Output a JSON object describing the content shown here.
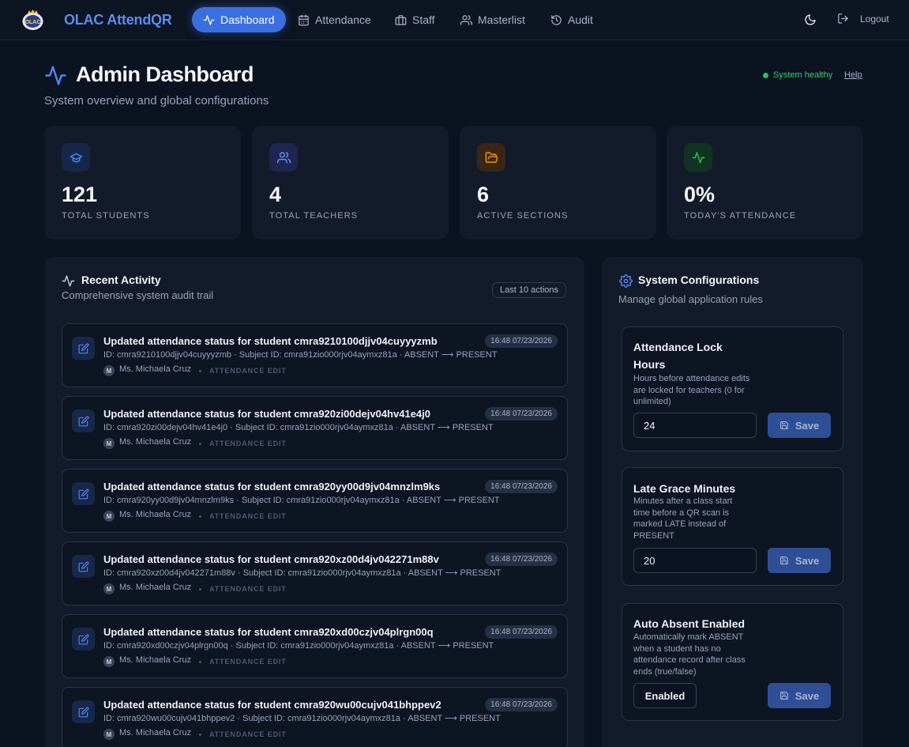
{
  "nav": {
    "brand": "OLAC AttendQR",
    "links": [
      {
        "label": "Dashboard",
        "icon": "activity-icon"
      },
      {
        "label": "Attendance",
        "icon": "calendar-icon"
      },
      {
        "label": "Staff",
        "icon": "briefcase-icon"
      },
      {
        "label": "Masterlist",
        "icon": "users-icon"
      },
      {
        "label": "Audit",
        "icon": "history-icon"
      }
    ],
    "logout_label": "Logout"
  },
  "header": {
    "title": "Admin Dashboard",
    "subtitle": "System overview and global configurations",
    "status": "System healthy",
    "help": "Help"
  },
  "stats": [
    {
      "value": "121",
      "label": "TOTAL STUDENTS",
      "icon": "graduation-cap-icon",
      "color": "#4f86f7"
    },
    {
      "value": "4",
      "label": "TOTAL TEACHERS",
      "icon": "users-icon",
      "color": "#6e8ff7"
    },
    {
      "value": "6",
      "label": "ACTIVE SECTIONS",
      "icon": "folder-open-icon",
      "color": "#f59e0b"
    },
    {
      "value": "0%",
      "label": "TODAY'S ATTENDANCE",
      "icon": "activity-icon",
      "color": "#22c55e"
    }
  ],
  "activity": {
    "title": "Recent Activity",
    "subtitle": "Comprehensive system audit trail",
    "badge": "Last 10 actions",
    "items": [
      {
        "title": "Updated attendance status for student cmra9210100djjv04cuyyyzmb",
        "time": "16:48 07/23/2026",
        "detail": "ID: cmra9210100djjv04cuyyyzmb · Subject ID: cmra91zio000rjv04aymxz81a · ABSENT ⟶ PRESENT",
        "avatar": "M",
        "user": "Ms. Michaela Cruz",
        "type": "ATTENDANCE EDIT"
      },
      {
        "title": "Updated attendance status for student cmra920zi00dejv04hv41e4j0",
        "time": "16:48 07/23/2026",
        "detail": "ID: cmra920zi00dejv04hv41e4j0 · Subject ID: cmra91zio000rjv04aymxz81a · ABSENT ⟶ PRESENT",
        "avatar": "M",
        "user": "Ms. Michaela Cruz",
        "type": "ATTENDANCE EDIT"
      },
      {
        "title": "Updated attendance status for student cmra920yy00d9jv04mnzlm9ks",
        "time": "16:48 07/23/2026",
        "detail": "ID: cmra920yy00d9jv04mnzlm9ks · Subject ID: cmra91zio000rjv04aymxz81a · ABSENT ⟶ PRESENT",
        "avatar": "M",
        "user": "Ms. Michaela Cruz",
        "type": "ATTENDANCE EDIT"
      },
      {
        "title": "Updated attendance status for student cmra920xz00d4jv042271m88v",
        "time": "16:48 07/23/2026",
        "detail": "ID: cmra920xz00d4jv042271m88v · Subject ID: cmra91zio000rjv04aymxz81a · ABSENT ⟶ PRESENT",
        "avatar": "M",
        "user": "Ms. Michaela Cruz",
        "type": "ATTENDANCE EDIT"
      },
      {
        "title": "Updated attendance status for student cmra920xd00czjv04plrgn00q",
        "time": "16:48 07/23/2026",
        "detail": "ID: cmra920xd00czjv04plrgn00q · Subject ID: cmra91zio000rjv04aymxz81a · ABSENT ⟶ PRESENT",
        "avatar": "M",
        "user": "Ms. Michaela Cruz",
        "type": "ATTENDANCE EDIT"
      },
      {
        "title": "Updated attendance status for student cmra920wu00cujv041bhppev2",
        "time": "16:48 07/23/2026",
        "detail": "ID: cmra920wu00cujv041bhppev2 · Subject ID: cmra91zio000rjv04aymxz81a · ABSENT ⟶ PRESENT",
        "avatar": "M",
        "user": "Ms. Michaela Cruz",
        "type": "ATTENDANCE EDIT"
      }
    ]
  },
  "config": {
    "title": "System Configurations",
    "subtitle": "Manage global application rules",
    "save_label": "Save",
    "items": [
      {
        "name": "Attendance Lock Hours",
        "desc": "Hours before attendance edits are locked for teachers (0 for unlimited)",
        "value": "24",
        "kind": "input"
      },
      {
        "name": "Late Grace Minutes",
        "desc": "Minutes after a class start time before a QR scan is marked LATE instead of PRESENT",
        "value": "20",
        "kind": "input"
      },
      {
        "name": "Auto Absent Enabled",
        "desc": "Automatically mark ABSENT when a student has no attendance record after class ends (true/false)",
        "value": "Enabled",
        "kind": "toggle"
      }
    ]
  }
}
